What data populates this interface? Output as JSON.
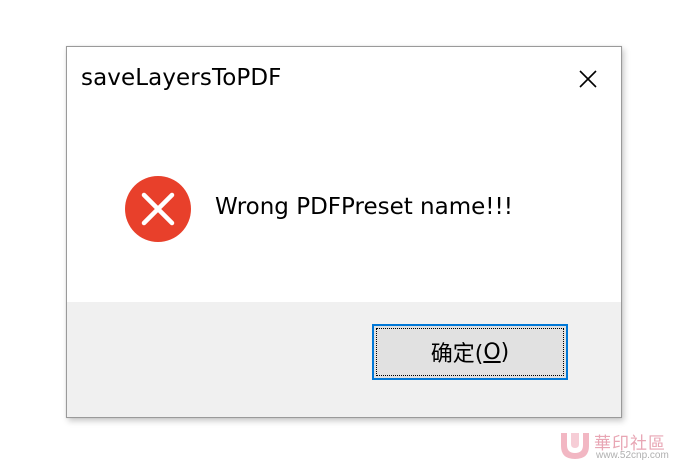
{
  "dialog": {
    "title": "saveLayersToPDF",
    "message": "Wrong PDFPreset name!!!",
    "ok_button": {
      "label_prefix": "确定(",
      "mnemonic": "O",
      "label_suffix": ")"
    },
    "icons": {
      "close": "close-icon",
      "error": "error-icon"
    },
    "colors": {
      "error_red": "#e8402b",
      "focus_blue": "#0078d7",
      "footer_bg": "#f0f0f0",
      "button_bg": "#e1e1e1"
    }
  },
  "watermark": {
    "title": "華印社區",
    "url": "www.52cnp.com"
  }
}
